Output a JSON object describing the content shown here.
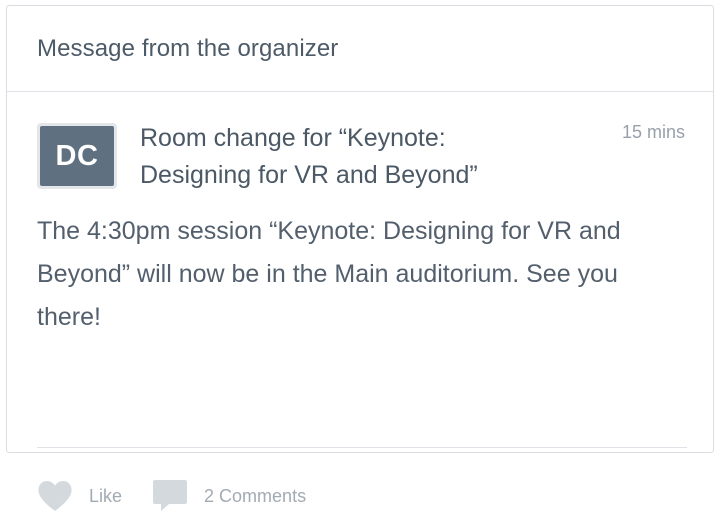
{
  "header": {
    "title": "Message from the organizer"
  },
  "message": {
    "avatar_initials": "DC",
    "title": "Room change for “Keynote: Designing for VR and Beyond”",
    "time": "15 mins",
    "body": "The 4:30pm session “Keynote: Designing for VR and Beyond” will now be in the Main auditorium. See you there!"
  },
  "actions": {
    "like_label": "Like",
    "comments_label": "2 Comments"
  },
  "icons": {
    "like": "heart-icon",
    "comments": "speech-bubble-icon"
  },
  "colors": {
    "avatar_bg": "#5f7081",
    "muted_text": "#a2aab3",
    "icon": "#d4d9de"
  }
}
